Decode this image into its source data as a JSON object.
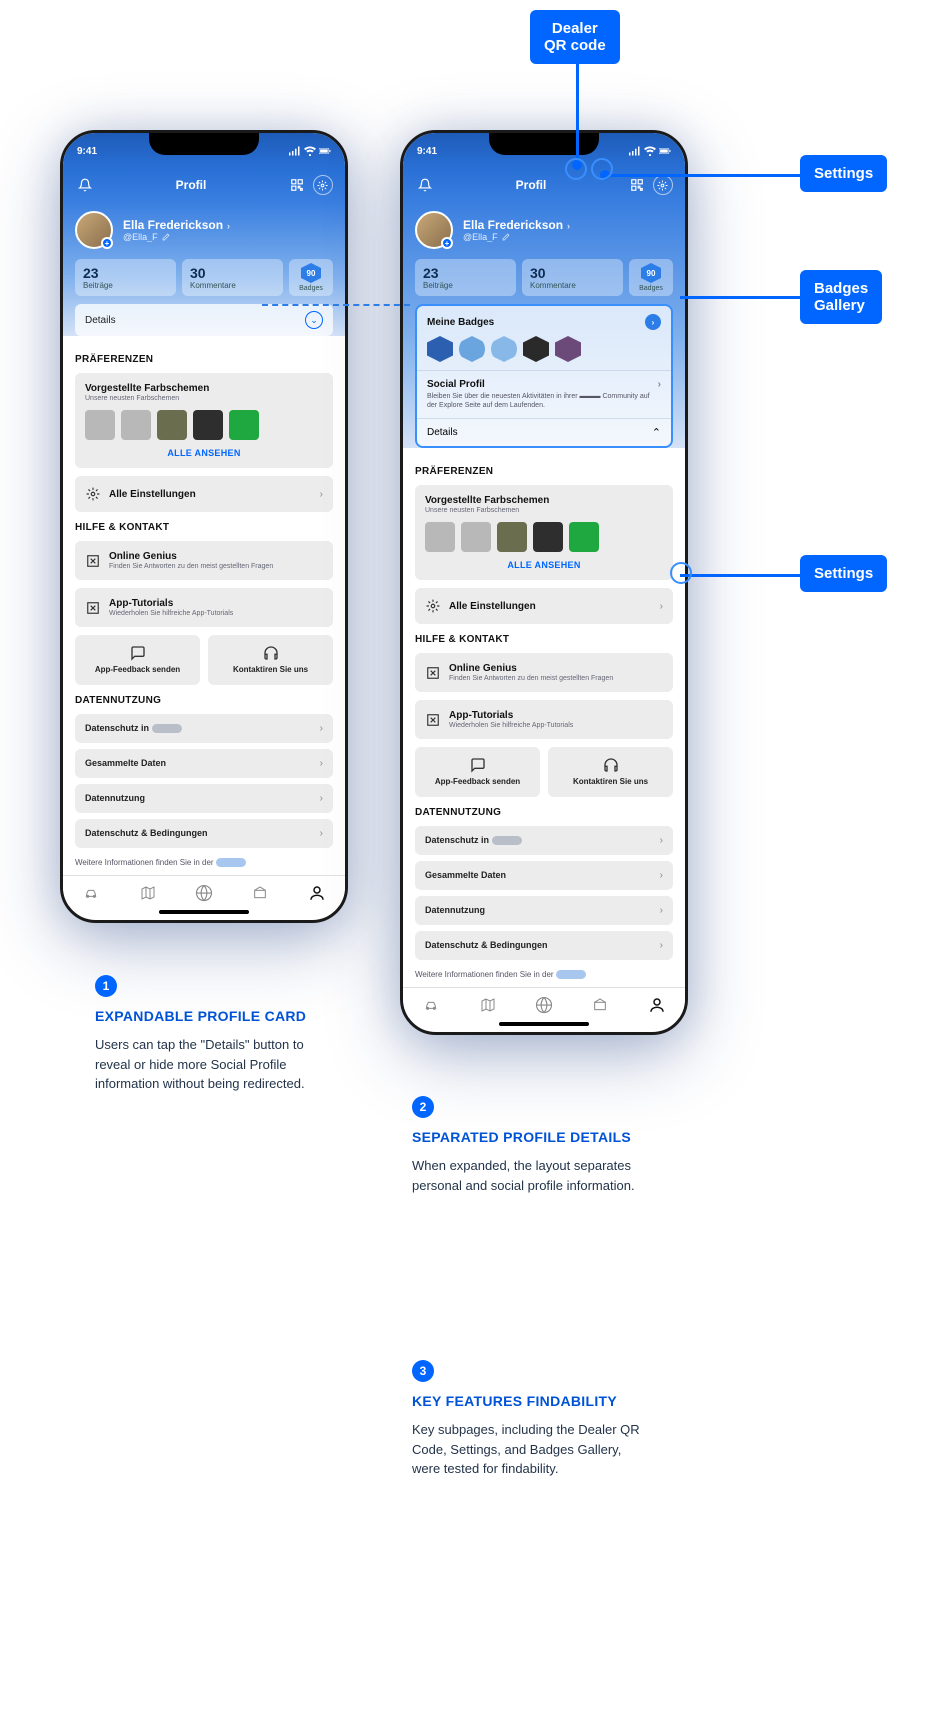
{
  "callouts": {
    "qr": "Dealer\nQR code",
    "settings": "Settings",
    "badges": "Badges\nGallery",
    "settings2": "Settings"
  },
  "status": {
    "time": "9:41"
  },
  "header": {
    "title": "Profil"
  },
  "profile": {
    "name": "Ella Frederickson",
    "handle": "@Ella_F",
    "stats": {
      "posts_num": "23",
      "posts_lbl": "Beiträge",
      "comments_num": "30",
      "comments_lbl": "Kommentare",
      "badges_num": "90",
      "badges_lbl": "Badges"
    },
    "details": "Details",
    "meine_badges": "Meine Badges",
    "social_title": "Social Profil",
    "social_desc": "Bleiben Sie über die neuesten Aktivitäten in ihrer ▬▬▬ Community auf der Explore Seite auf dem Laufenden."
  },
  "prefs": {
    "hd": "PRÄFERENZEN",
    "color_title": "Vorgestellte Farbschemen",
    "color_sub": "Unsere neusten Farbschemen",
    "alle": "ALLE ANSEHEN",
    "settings": "Alle Einstellungen",
    "colors": [
      "#b8b8b8",
      "#b8b8b8",
      "#6b6d4f",
      "#2e2e2e",
      "#1ea83f"
    ]
  },
  "help": {
    "hd": "HILFE & KONTAKT",
    "og_title": "Online Genius",
    "og_sub": "Finden Sie Antworten zu den meist gestellten Fragen",
    "tut_title": "App-Tutorials",
    "tut_sub": "Wiederholen Sie hilfreiche App-Tutorials",
    "feedback": "App-Feedback senden",
    "contact": "Kontaktiren Sie uns"
  },
  "data": {
    "hd": "DATENNUTZUNG",
    "rows": [
      "Datenschutz in ▬▬▬",
      "Gesammelte Daten",
      "Datennutzung",
      "Datenschutz & Bedingungen"
    ],
    "footer": "Weitere Informationen finden Sie in der "
  },
  "annotations": {
    "a1_title": "EXPANDABLE PROFILE CARD",
    "a1_body": "Users can tap the \"Details\" button to reveal or hide more Social Profile information without being redirected.",
    "a2_title": "SEPARATED PROFILE DETAILS",
    "a2_body": "When expanded, the layout separates personal and social profile information.",
    "a3_title": "KEY FEATURES FINDABILITY",
    "a3_body": "Key subpages, including the Dealer QR Code, Settings, and Badges Gallery, were tested for findability."
  }
}
